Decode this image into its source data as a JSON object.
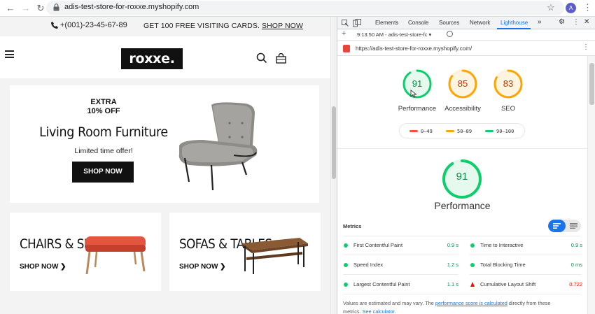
{
  "browser": {
    "url": "adis-test-store-for-roxxe.myshopify.com",
    "avatar_initial": "A"
  },
  "store": {
    "phone": "+(001)-23-45-67-89",
    "promo_text": "GET 100 FREE VISITING CARDS.",
    "promo_link": "SHOP NOW",
    "logo": "roxxe.",
    "hero": {
      "extra_line1": "EXTRA",
      "extra_line2": "10% OFF",
      "title": "Living Room Furniture",
      "subtitle": "Limited time offer!",
      "button": "SHOP NOW"
    },
    "categories": [
      {
        "title": "CHAIRS & SETS",
        "link": "SHOP NOW"
      },
      {
        "title": "SOFAS & TABLES",
        "link": "SHOP NOW"
      }
    ]
  },
  "devtools": {
    "tabs": [
      "Elements",
      "Console",
      "Sources",
      "Network",
      "Lighthouse"
    ],
    "more": "»",
    "report_time": "9:13:50 AM - adis-test-store-fc",
    "audited_url": "https://adis-test-store-for-roxxe.myshopify.com/",
    "scores": [
      {
        "label": "Performance",
        "score": 91,
        "color": "#0cce6b",
        "text_color": "#0a8a48"
      },
      {
        "label": "Accessibility",
        "score": 85,
        "color": "#ffa400",
        "text_color": "#c33300"
      },
      {
        "label": "SEO",
        "score": 83,
        "color": "#ffa400",
        "text_color": "#c33300"
      }
    ],
    "legend": [
      {
        "range": "0–49",
        "color": "#ff4e42"
      },
      {
        "range": "50–89",
        "color": "#ffa400"
      },
      {
        "range": "90–100",
        "color": "#0cce6b"
      }
    ],
    "big_score": {
      "score": 91,
      "title": "Performance"
    },
    "metrics_header": "Metrics",
    "metrics": [
      {
        "label": "First Contentful Paint",
        "value": "0.9 s",
        "status": "pass"
      },
      {
        "label": "Time to Interactive",
        "value": "0.9 s",
        "status": "pass"
      },
      {
        "label": "Speed Index",
        "value": "1.2 s",
        "status": "pass"
      },
      {
        "label": "Total Blocking Time",
        "value": "0 ms",
        "status": "pass"
      },
      {
        "label": "Largest Contentful Paint",
        "value": "1.1 s",
        "status": "pass"
      },
      {
        "label": "Cumulative Layout Shift",
        "value": "0.722",
        "status": "fail"
      }
    ],
    "footer_text_1": "Values are estimated and may vary. The",
    "footer_link_1": "performance score is calculated",
    "footer_text_2": "directly from these",
    "footer_text_3": "metrics.",
    "footer_link_2": "See calculator."
  }
}
